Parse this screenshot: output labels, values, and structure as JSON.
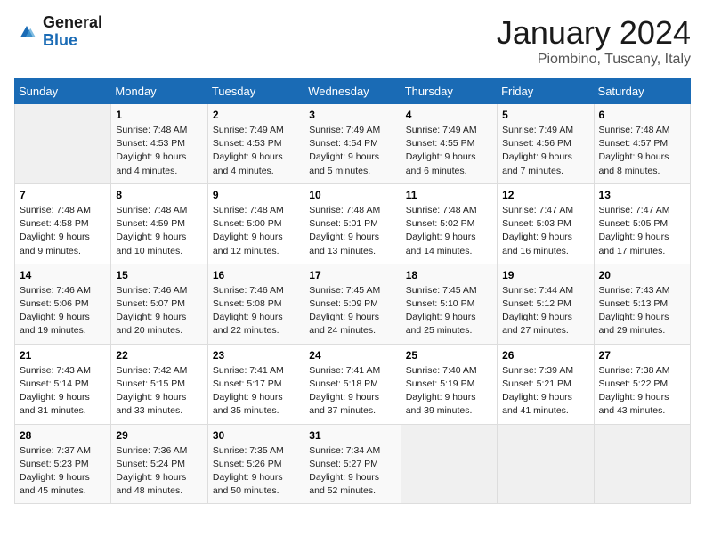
{
  "header": {
    "logo_line1": "General",
    "logo_line2": "Blue",
    "title": "January 2024",
    "subtitle": "Piombino, Tuscany, Italy"
  },
  "calendar": {
    "days_of_week": [
      "Sunday",
      "Monday",
      "Tuesday",
      "Wednesday",
      "Thursday",
      "Friday",
      "Saturday"
    ],
    "weeks": [
      [
        {
          "day": "",
          "detail": ""
        },
        {
          "day": "1",
          "detail": "Sunrise: 7:48 AM\nSunset: 4:53 PM\nDaylight: 9 hours\nand 4 minutes."
        },
        {
          "day": "2",
          "detail": "Sunrise: 7:49 AM\nSunset: 4:53 PM\nDaylight: 9 hours\nand 4 minutes."
        },
        {
          "day": "3",
          "detail": "Sunrise: 7:49 AM\nSunset: 4:54 PM\nDaylight: 9 hours\nand 5 minutes."
        },
        {
          "day": "4",
          "detail": "Sunrise: 7:49 AM\nSunset: 4:55 PM\nDaylight: 9 hours\nand 6 minutes."
        },
        {
          "day": "5",
          "detail": "Sunrise: 7:49 AM\nSunset: 4:56 PM\nDaylight: 9 hours\nand 7 minutes."
        },
        {
          "day": "6",
          "detail": "Sunrise: 7:48 AM\nSunset: 4:57 PM\nDaylight: 9 hours\nand 8 minutes."
        }
      ],
      [
        {
          "day": "7",
          "detail": "Sunrise: 7:48 AM\nSunset: 4:58 PM\nDaylight: 9 hours\nand 9 minutes."
        },
        {
          "day": "8",
          "detail": "Sunrise: 7:48 AM\nSunset: 4:59 PM\nDaylight: 9 hours\nand 10 minutes."
        },
        {
          "day": "9",
          "detail": "Sunrise: 7:48 AM\nSunset: 5:00 PM\nDaylight: 9 hours\nand 12 minutes."
        },
        {
          "day": "10",
          "detail": "Sunrise: 7:48 AM\nSunset: 5:01 PM\nDaylight: 9 hours\nand 13 minutes."
        },
        {
          "day": "11",
          "detail": "Sunrise: 7:48 AM\nSunset: 5:02 PM\nDaylight: 9 hours\nand 14 minutes."
        },
        {
          "day": "12",
          "detail": "Sunrise: 7:47 AM\nSunset: 5:03 PM\nDaylight: 9 hours\nand 16 minutes."
        },
        {
          "day": "13",
          "detail": "Sunrise: 7:47 AM\nSunset: 5:05 PM\nDaylight: 9 hours\nand 17 minutes."
        }
      ],
      [
        {
          "day": "14",
          "detail": "Sunrise: 7:46 AM\nSunset: 5:06 PM\nDaylight: 9 hours\nand 19 minutes."
        },
        {
          "day": "15",
          "detail": "Sunrise: 7:46 AM\nSunset: 5:07 PM\nDaylight: 9 hours\nand 20 minutes."
        },
        {
          "day": "16",
          "detail": "Sunrise: 7:46 AM\nSunset: 5:08 PM\nDaylight: 9 hours\nand 22 minutes."
        },
        {
          "day": "17",
          "detail": "Sunrise: 7:45 AM\nSunset: 5:09 PM\nDaylight: 9 hours\nand 24 minutes."
        },
        {
          "day": "18",
          "detail": "Sunrise: 7:45 AM\nSunset: 5:10 PM\nDaylight: 9 hours\nand 25 minutes."
        },
        {
          "day": "19",
          "detail": "Sunrise: 7:44 AM\nSunset: 5:12 PM\nDaylight: 9 hours\nand 27 minutes."
        },
        {
          "day": "20",
          "detail": "Sunrise: 7:43 AM\nSunset: 5:13 PM\nDaylight: 9 hours\nand 29 minutes."
        }
      ],
      [
        {
          "day": "21",
          "detail": "Sunrise: 7:43 AM\nSunset: 5:14 PM\nDaylight: 9 hours\nand 31 minutes."
        },
        {
          "day": "22",
          "detail": "Sunrise: 7:42 AM\nSunset: 5:15 PM\nDaylight: 9 hours\nand 33 minutes."
        },
        {
          "day": "23",
          "detail": "Sunrise: 7:41 AM\nSunset: 5:17 PM\nDaylight: 9 hours\nand 35 minutes."
        },
        {
          "day": "24",
          "detail": "Sunrise: 7:41 AM\nSunset: 5:18 PM\nDaylight: 9 hours\nand 37 minutes."
        },
        {
          "day": "25",
          "detail": "Sunrise: 7:40 AM\nSunset: 5:19 PM\nDaylight: 9 hours\nand 39 minutes."
        },
        {
          "day": "26",
          "detail": "Sunrise: 7:39 AM\nSunset: 5:21 PM\nDaylight: 9 hours\nand 41 minutes."
        },
        {
          "day": "27",
          "detail": "Sunrise: 7:38 AM\nSunset: 5:22 PM\nDaylight: 9 hours\nand 43 minutes."
        }
      ],
      [
        {
          "day": "28",
          "detail": "Sunrise: 7:37 AM\nSunset: 5:23 PM\nDaylight: 9 hours\nand 45 minutes."
        },
        {
          "day": "29",
          "detail": "Sunrise: 7:36 AM\nSunset: 5:24 PM\nDaylight: 9 hours\nand 48 minutes."
        },
        {
          "day": "30",
          "detail": "Sunrise: 7:35 AM\nSunset: 5:26 PM\nDaylight: 9 hours\nand 50 minutes."
        },
        {
          "day": "31",
          "detail": "Sunrise: 7:34 AM\nSunset: 5:27 PM\nDaylight: 9 hours\nand 52 minutes."
        },
        {
          "day": "",
          "detail": ""
        },
        {
          "day": "",
          "detail": ""
        },
        {
          "day": "",
          "detail": ""
        }
      ]
    ]
  }
}
